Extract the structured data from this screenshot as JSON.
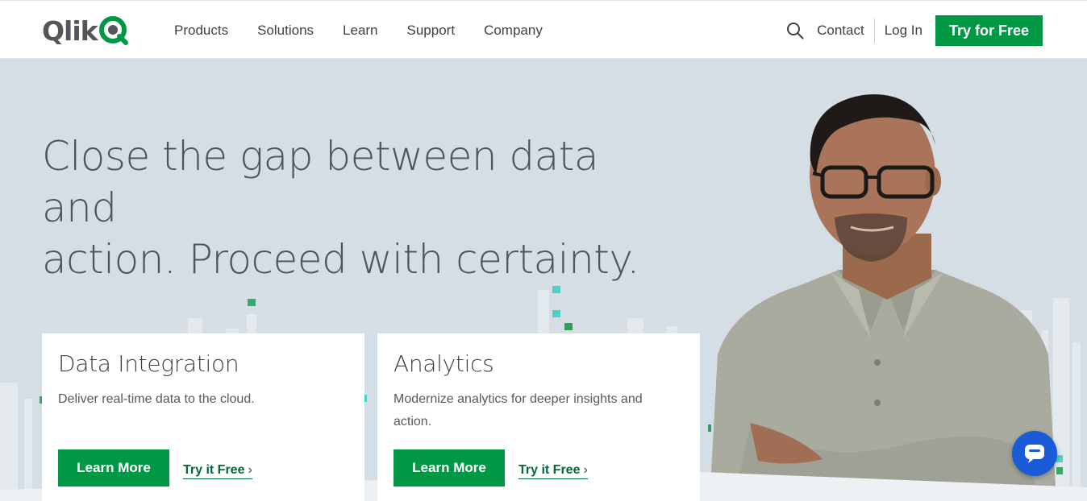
{
  "header": {
    "logo_text": "Qlik",
    "nav": [
      "Products",
      "Solutions",
      "Learn",
      "Support",
      "Company"
    ],
    "contact_label": "Contact",
    "login_label": "Log In",
    "try_label": "Try for Free"
  },
  "hero": {
    "title_line1": "Close the gap between data and",
    "title_line2": "action. Proceed with certainty."
  },
  "cards": [
    {
      "title": "Data Integration",
      "desc": "Deliver real-time data to the cloud.",
      "learn_label": "Learn More",
      "try_label": "Try it Free"
    },
    {
      "title": "Analytics",
      "desc": "Modernize analytics for deeper insights and action.",
      "learn_label": "Learn More",
      "try_label": "Try it Free"
    }
  ],
  "icons": {
    "search": "search-icon",
    "chevron": "chevron-right-icon",
    "chat": "chat-icon",
    "logo_mark": "qlik-q-icon"
  },
  "colors": {
    "brand_green": "#009845",
    "link_green": "#006a37",
    "hero_bg": "#d5dde5",
    "chat_blue": "#1a5bd8"
  }
}
